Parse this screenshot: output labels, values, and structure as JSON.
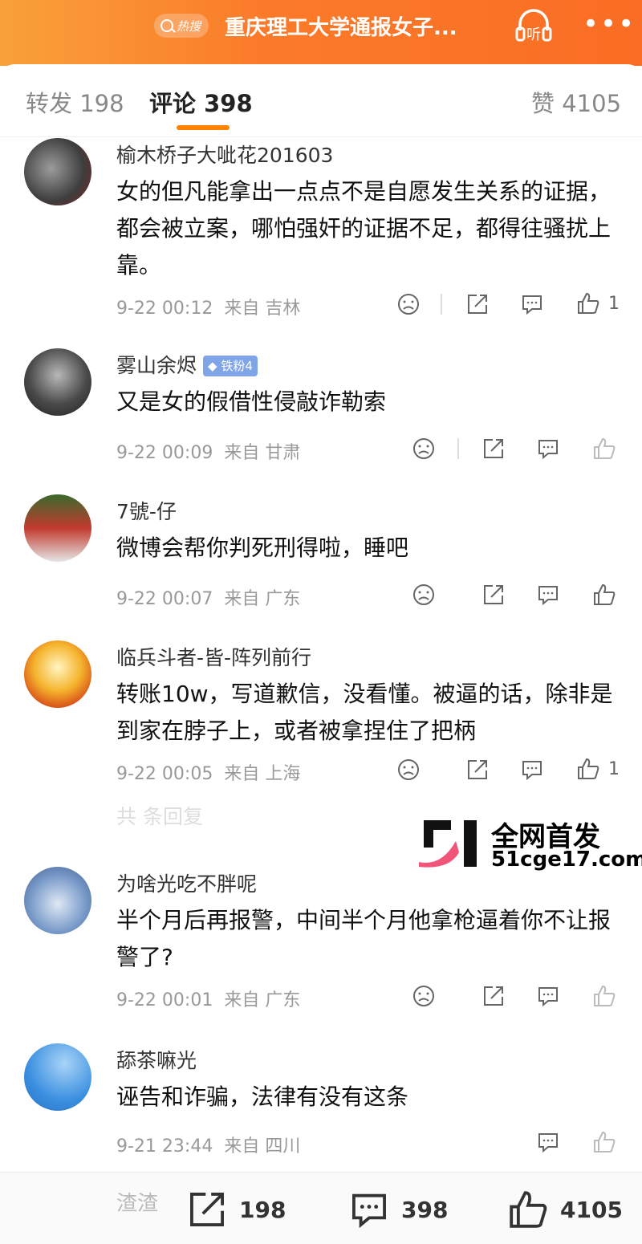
{
  "header": {
    "hot_badge": "热搜",
    "title": "重庆理工大学通报女子...",
    "listen_label": "听"
  },
  "tabs": {
    "repost": "转发 198",
    "comments": "评论 398",
    "likes": "赞 4105"
  },
  "comments": [
    {
      "user": "榆木桥子大呲花201603",
      "text": "女的但凡能拿出一点点不是自愿发生关系的证据，都会被立案，哪怕强奸的证据不足，都得往骚扰上靠。",
      "time": "9-22 00:12",
      "from": "来自 吉林",
      "likes": "1"
    },
    {
      "user": "雾山余烬",
      "badge": "铁粉4",
      "text": "又是女的假借性侵敲诈勒索",
      "time": "9-22 00:09",
      "from": "来自 甘肃",
      "likes": ""
    },
    {
      "user": "7號-仔",
      "text": "微博会帮你判死刑得啦，睡吧",
      "time": "9-22 00:07",
      "from": "来自 广东",
      "likes": ""
    },
    {
      "user": "临兵斗者-皆-阵列前行",
      "text": "转账10w，写道歉信，没看懂。被逼的话，除非是到家在脖子上，或者被拿捏住了把柄",
      "time": "9-22 00:05",
      "from": "来自 上海",
      "likes": "1"
    },
    {
      "user": "为啥光吃不胖呢",
      "text": "半个月后再报警，中间半个月他拿枪逼着你不让报警了?",
      "time": "9-22 00:01",
      "from": "来自 广东",
      "likes": ""
    },
    {
      "user": "舔茶嘛光",
      "text": "诬告和诈骗，法律有没有这条",
      "time": "9-21 23:44",
      "from": "来自 四川",
      "likes": ""
    }
  ],
  "faded_row": "共 条回复",
  "watermark": {
    "line1": "全网首发",
    "line2": "51cge17.com"
  },
  "bottom_bar": {
    "peek": "渣渣",
    "reposts": "198",
    "comments": "398",
    "likes": "4105"
  },
  "colors": {
    "accent": "#ff8200",
    "header_gradient_start": "#f9a13a",
    "header_gradient_end": "#fa6d24"
  }
}
